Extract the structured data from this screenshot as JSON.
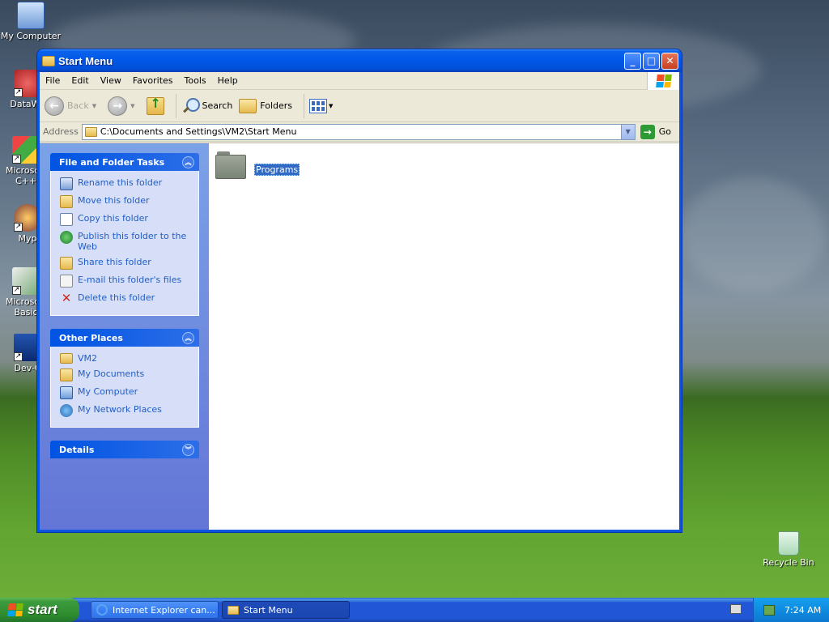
{
  "desktop": {
    "icons": [
      {
        "label": "My Computer"
      },
      {
        "label": "DataWa"
      },
      {
        "label": "Microsoft C++"
      },
      {
        "label": "Myp"
      },
      {
        "label": "Microsoft Basic"
      },
      {
        "label": "Dev-C"
      },
      {
        "label": "Recycle Bin"
      }
    ]
  },
  "window": {
    "title": "Start Menu",
    "menu": [
      "File",
      "Edit",
      "View",
      "Favorites",
      "Tools",
      "Help"
    ],
    "toolbar": {
      "back": "Back",
      "search": "Search",
      "folders": "Folders"
    },
    "address": {
      "label": "Address",
      "value": "C:\\Documents and Settings\\VM2\\Start Menu",
      "go": "Go"
    },
    "taskpane": {
      "file_tasks": {
        "title": "File and Folder Tasks",
        "items": [
          "Rename this folder",
          "Move this folder",
          "Copy this folder",
          "Publish this folder to the Web",
          "Share this folder",
          "E-mail this folder's files",
          "Delete this folder"
        ]
      },
      "other_places": {
        "title": "Other Places",
        "items": [
          "VM2",
          "My Documents",
          "My Computer",
          "My Network Places"
        ]
      },
      "details": {
        "title": "Details"
      }
    },
    "files": [
      {
        "name": "Programs"
      }
    ]
  },
  "taskbar": {
    "start": "start",
    "buttons": [
      "Internet Explorer can...",
      "Start Menu"
    ],
    "clock": "7:24 AM"
  }
}
